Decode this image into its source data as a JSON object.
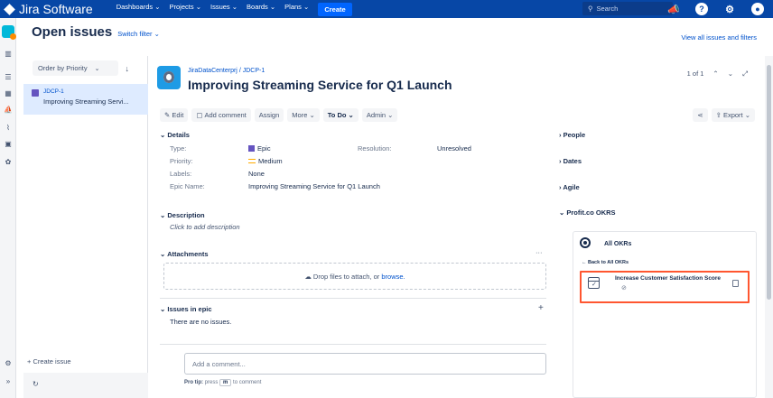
{
  "topbar": {
    "brand": "Jira Software",
    "nav": [
      "Dashboards ⌄",
      "Projects ⌄",
      "Issues ⌄",
      "Boards ⌄",
      "Plans ⌄"
    ],
    "create_label": "Create",
    "search_placeholder": "Search"
  },
  "header": {
    "title": "Open issues",
    "switch_filter": "Switch filter ⌄",
    "view_all": "View all issues and filters"
  },
  "list": {
    "order_by": "Order by Priority",
    "items": [
      {
        "key": "JDCP-1",
        "summary": "Improving Streaming Servi..."
      }
    ],
    "create_issue": "+ Create issue"
  },
  "issue": {
    "project": "JiraDataCenterprj",
    "key": "JDCP-1",
    "breadcrumb_sep": "/",
    "title": "Improving Streaming Service for Q1 Launch",
    "pager": "1 of 1",
    "toolbar": {
      "edit": "Edit",
      "add_comment": "Add comment",
      "assign": "Assign",
      "more": "More ⌄",
      "status": "To Do ⌄",
      "admin": "Admin ⌄",
      "export": "Export ⌄"
    },
    "details": {
      "heading": "Details",
      "type_label": "Type:",
      "type_value": "Epic",
      "priority_label": "Priority:",
      "priority_value": "Medium",
      "labels_label": "Labels:",
      "labels_value": "None",
      "epicname_label": "Epic Name:",
      "epicname_value": "Improving Streaming Service for Q1 Launch",
      "resolution_label": "Resolution:",
      "resolution_value": "Unresolved"
    },
    "description": {
      "heading": "Description",
      "placeholder": "Click to add description"
    },
    "attachments": {
      "heading": "Attachments",
      "drop_text": "Drop files to attach, or",
      "browse": "browse."
    },
    "issues_in_epic": {
      "heading": "Issues in epic",
      "empty": "There are no issues."
    },
    "comment": {
      "placeholder": "Add a comment...",
      "protip_prefix": "Pro tip:",
      "protip_press": "press",
      "protip_key": "m",
      "protip_suffix": "to comment"
    }
  },
  "side": {
    "people": "People",
    "dates": "Dates",
    "agile": "Agile",
    "profit": "Profit.co OKRS",
    "okr_title": "All OKRs",
    "okr_back": "← Back to All OKRs",
    "okr_card_title": "Increase Customer Satisfaction Score"
  },
  "colors": {
    "topbar": "#0747A6",
    "highlight": "#FF5630",
    "link": "#0052CC"
  }
}
